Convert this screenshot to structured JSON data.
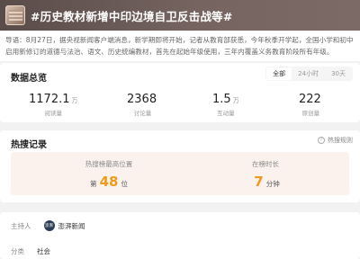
{
  "header": {
    "title": "#历史教材新增中印边境自卫反击战等#"
  },
  "lead": {
    "label": "导语：",
    "text": "8月27日，据央视新闻客户端消息，新学期即将开始，记者从教育部获悉，今年秋季开学起，全国小学和初中启用新修订的道德与法治、语文、历史统编教材，首先在起始年级使用，三年内覆盖义务教育阶段所有年级。"
  },
  "data_card": {
    "title": "数据总览",
    "tabs": [
      "全部",
      "24小时",
      "30天"
    ],
    "active_tab": "全部",
    "stats": [
      {
        "value": "1172.1",
        "unit": "万",
        "label": "阅读量"
      },
      {
        "value": "2368",
        "unit": "",
        "label": "讨论量"
      },
      {
        "value": "1.5",
        "unit": "万",
        "label": "互动量"
      },
      {
        "value": "222",
        "unit": "",
        "label": "原创量"
      }
    ]
  },
  "hot_card": {
    "title": "热搜记录",
    "rule_link": "热搜规则",
    "peak_caption": "热搜榜最高位置",
    "peak_prefix": "第",
    "peak_value": "48",
    "peak_suffix": "位",
    "duration_caption": "在榜时长",
    "duration_value": "7",
    "duration_unit": "分钟"
  },
  "info_card": {
    "host_label": "主持人",
    "host_avatar_text": "澎湃",
    "host_name": "澎湃新闻",
    "category_label": "分类",
    "category_value": "社会"
  },
  "colors": {
    "accent_orange": "#f09a1a",
    "header_bg": "#5a4c49"
  }
}
